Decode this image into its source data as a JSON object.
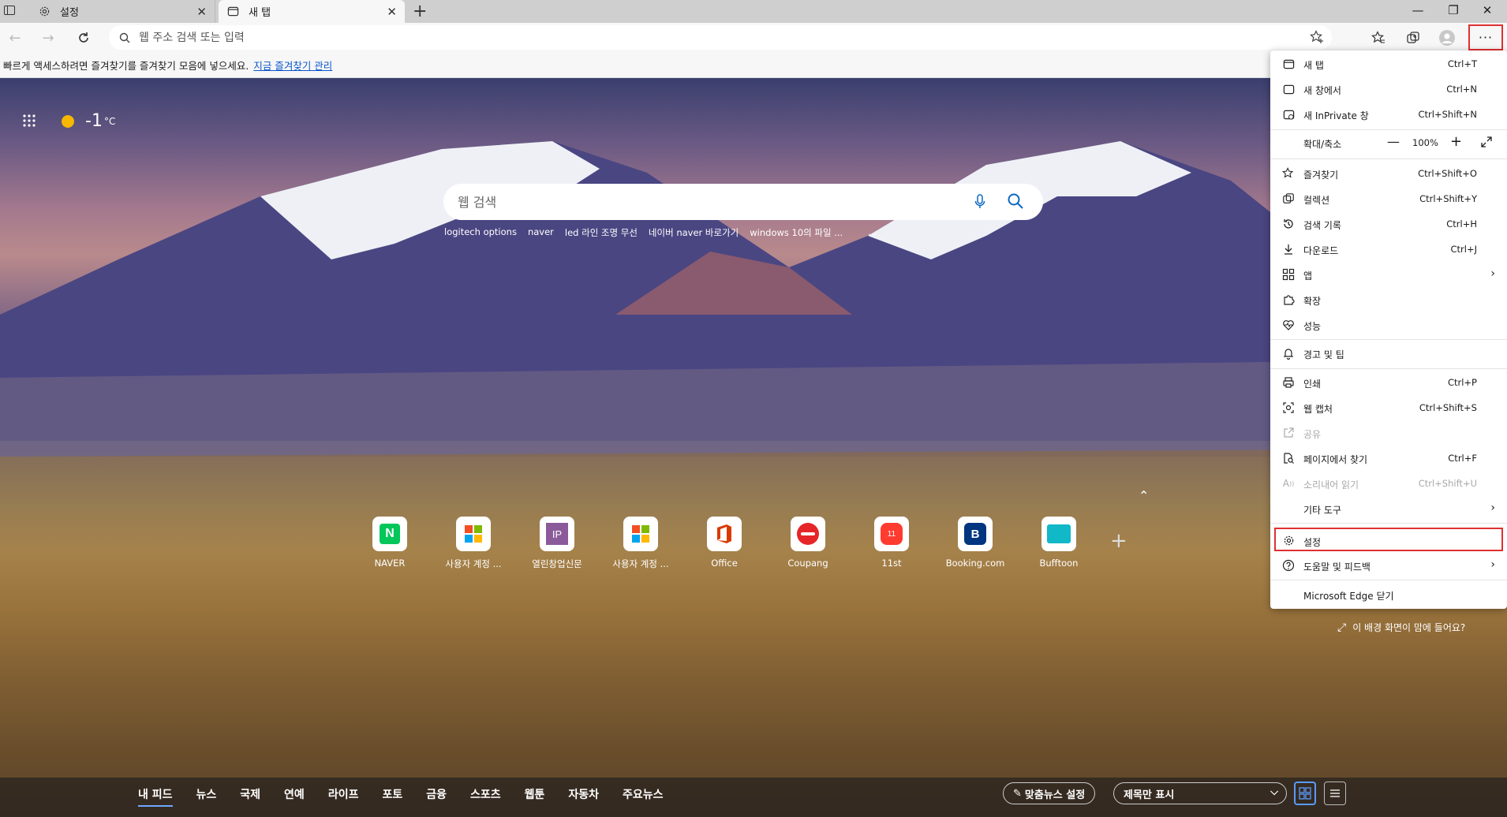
{
  "tabs": [
    {
      "title": "설정",
      "icon": "gear-icon"
    },
    {
      "title": "새 탭",
      "icon": "newtab-icon"
    }
  ],
  "address_bar": {
    "placeholder": "웹 주소 검색 또는 입력"
  },
  "favorites_bar": {
    "message": "빠르게 액세스하려면 즐겨찾기를 즐겨찾기 모음에 넣으세요.",
    "link": "지금 즐겨찾기 관리"
  },
  "weather": {
    "temperature": "-1",
    "unit": "°C"
  },
  "search": {
    "placeholder": "웹 검색",
    "trending": [
      "logitech options",
      "naver",
      "led 라인 조명 무선",
      "네이버 naver 바로가기",
      "windows 10의 파일 ..."
    ],
    "more": "..."
  },
  "quick_links": [
    {
      "label": "NAVER",
      "icon": "naver-icon",
      "color": "#03c75a"
    },
    {
      "label": "사용자 계정 ...",
      "icon": "microsoft-icon",
      "color": "#f25022"
    },
    {
      "label": "열린창업신문",
      "icon": "ip-icon",
      "color": "#7a4a8a"
    },
    {
      "label": "사용자 계정 ...",
      "icon": "microsoft-icon",
      "color": "#f25022"
    },
    {
      "label": "Office",
      "icon": "office-icon",
      "color": "#d83b01"
    },
    {
      "label": "Coupang",
      "icon": "coupang-icon",
      "color": "#e52528"
    },
    {
      "label": "11st",
      "icon": "11st-icon",
      "color": "#ff3b30"
    },
    {
      "label": "Booking.com",
      "icon": "booking-icon",
      "color": "#003580"
    },
    {
      "label": "Bufftoon",
      "icon": "bufftoon-icon",
      "color": "#10b8c8"
    }
  ],
  "background_prompt": "이 배경 화면이 맘에 들어요?",
  "feed": {
    "tabs": [
      "내 피드",
      "뉴스",
      "국제",
      "연예",
      "라이프",
      "포토",
      "금융",
      "스포츠",
      "웹툰",
      "자동차",
      "주요뉴스"
    ],
    "personalize": "맞춤뉴스 설정",
    "layout": "제목만 표시"
  },
  "menu": {
    "new_tab": {
      "label": "새 탭",
      "shortcut": "Ctrl+T"
    },
    "new_window": {
      "label": "새 창에서",
      "shortcut": "Ctrl+N"
    },
    "inprivate": {
      "label": "새 InPrivate 창",
      "shortcut": "Ctrl+Shift+N"
    },
    "zoom": {
      "label": "확대/축소",
      "value": "100%"
    },
    "favorites": {
      "label": "즐겨찾기",
      "shortcut": "Ctrl+Shift+O"
    },
    "collections": {
      "label": "컬렉션",
      "shortcut": "Ctrl+Shift+Y"
    },
    "history": {
      "label": "검색 기록",
      "shortcut": "Ctrl+H"
    },
    "downloads": {
      "label": "다운로드",
      "shortcut": "Ctrl+J"
    },
    "apps": {
      "label": "앱"
    },
    "extensions": {
      "label": "확장"
    },
    "performance": {
      "label": "성능"
    },
    "alerts": {
      "label": "경고 및 팁"
    },
    "print": {
      "label": "인쇄",
      "shortcut": "Ctrl+P"
    },
    "web_capture": {
      "label": "웹 캡처",
      "shortcut": "Ctrl+Shift+S"
    },
    "share": {
      "label": "공유"
    },
    "find": {
      "label": "페이지에서 찾기",
      "shortcut": "Ctrl+F"
    },
    "read_aloud": {
      "label": "소리내어 읽기",
      "shortcut": "Ctrl+Shift+U"
    },
    "more_tools": {
      "label": "기타 도구"
    },
    "settings": {
      "label": "설정"
    },
    "help": {
      "label": "도움말 및 피드백"
    },
    "close": {
      "label": "Microsoft Edge 닫기"
    }
  },
  "colors": {
    "highlight": "#e03030",
    "link": "#0a55c8"
  }
}
